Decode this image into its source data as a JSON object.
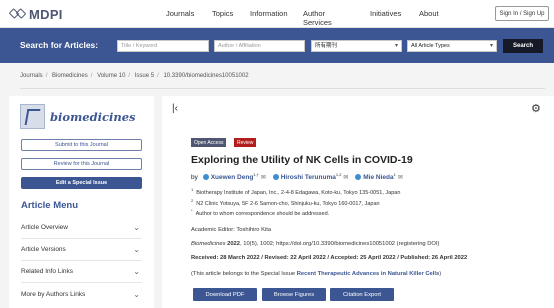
{
  "header": {
    "logo_text": "MDPI",
    "nav": [
      "Journals",
      "Topics",
      "Information",
      "Author Services",
      "Initiatives",
      "About"
    ],
    "signin_label": "Sign In / Sign Up"
  },
  "search": {
    "label": "Search for Articles:",
    "title_placeholder": "Title / Keyword",
    "author_placeholder": "Author / Affiliation",
    "journal_value": "所有期刊",
    "type_value": "All Article Types",
    "button_label": "Search"
  },
  "breadcrumb": [
    "Journals",
    "Biomedicines",
    "Volume 10",
    "Issue 5",
    "10.3390/biomedicines10051002"
  ],
  "sidebar": {
    "journal_name": "biomedicines",
    "submit_label": "Submit to this Journal",
    "review_label": "Review for this Journal",
    "special_issue_label": "Edit a Special Issue",
    "menu_title": "Article Menu",
    "menu_items": [
      "Article Overview",
      "Article Versions",
      "Related Info Links",
      "More by Authors Links"
    ]
  },
  "article": {
    "badge_open_access": "Open Access",
    "badge_review": "Review",
    "title": "Exploring the Utility of NK Cells in COVID-19",
    "by": "by",
    "authors": [
      {
        "name": "Xuewen Deng",
        "sup": "1,†"
      },
      {
        "name": "Hiroshi Terunuma",
        "sup": "1,2"
      },
      {
        "name": "Mie Nieda",
        "sup": "1"
      }
    ],
    "affiliations": [
      {
        "sup": "1",
        "text": "Biotherapy Institute of Japan, Inc., 2-4-8 Edagawa, Koto-ku, Tokyo 135-0051, Japan"
      },
      {
        "sup": "2",
        "text": "N2 Clinic Yotsuya, 5F 2-6 Samon-cho, Shinjuku-ku, Tokyo 160-0017, Japan"
      },
      {
        "sup": "*",
        "text": "Author to whom correspondence should be addressed."
      }
    ],
    "editor": "Academic Editor: Toshihiro Kita",
    "citation_journal": "Biomedicines",
    "citation_year": "2022",
    "citation_rest": ", 10(5), 1002; https://doi.org/10.3390/biomedicines10051002 (registering DOI)",
    "dates": "Received: 28 March 2022 / Revised: 22 April 2022 / Accepted: 25 April 2022 / Published: 26 April 2022",
    "special_issue_prefix": "(This article belongs to the Special Issue ",
    "special_issue_link": "Recent Therapeutic Advances in Natural Killer Cells",
    "special_issue_suffix": ")",
    "buttons": {
      "download_pdf": "Download PDF",
      "browse_figures": "Browse Figures",
      "citation_export": "Citation Export"
    }
  }
}
